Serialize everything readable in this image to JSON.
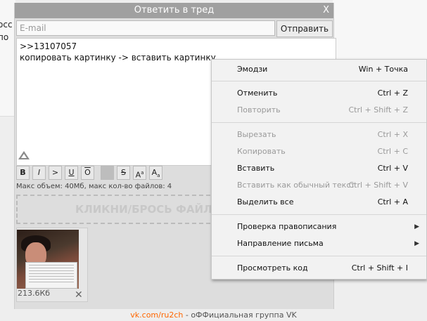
{
  "background": {
    "left_snippet": [
      "осс",
      "по"
    ],
    "footer_link": "vk.com/ru2ch",
    "footer_text": " - оФФициальная группа VK"
  },
  "panel": {
    "title": "Ответить в тред",
    "close_label": "X",
    "email_placeholder": "E-mail",
    "send_label": "Отправить",
    "message_lines": [
      ">>13107057",
      "копировать картинку -> вставить картинку"
    ],
    "format_buttons": [
      "B",
      "I",
      ">",
      "U",
      "O",
      "",
      "S",
      "A",
      "A"
    ],
    "limits_text": "Макс объем: 40Мб, макс кол-во файлов: 4",
    "dropzone_text": "КЛИКНИ/БРОСЬ ФАЙЛЫ",
    "attachment": {
      "size": "213.6Кб",
      "delete_label": "✕"
    }
  },
  "context_menu": {
    "items": [
      {
        "label": "Эмодзи",
        "shortcut": "Win + Точка",
        "enabled": true
      },
      {
        "label": "Отменить",
        "shortcut": "Ctrl + Z",
        "enabled": true
      },
      {
        "label": "Повторить",
        "shortcut": "Ctrl + Shift + Z",
        "enabled": false
      },
      {
        "label": "Вырезать",
        "shortcut": "Ctrl + X",
        "enabled": false
      },
      {
        "label": "Копировать",
        "shortcut": "Ctrl + C",
        "enabled": false
      },
      {
        "label": "Вставить",
        "shortcut": "Ctrl + V",
        "enabled": true
      },
      {
        "label": "Вставить как обычный текст",
        "shortcut": "Ctrl + Shift + V",
        "enabled": false
      },
      {
        "label": "Выделить все",
        "shortcut": "Ctrl + A",
        "enabled": true
      },
      {
        "label": "Проверка правописания",
        "shortcut": "",
        "enabled": true,
        "submenu": true
      },
      {
        "label": "Направление письма",
        "shortcut": "",
        "enabled": true,
        "submenu": true
      },
      {
        "label": "Просмотреть код",
        "shortcut": "Ctrl + Shift + I",
        "enabled": true
      }
    ]
  }
}
